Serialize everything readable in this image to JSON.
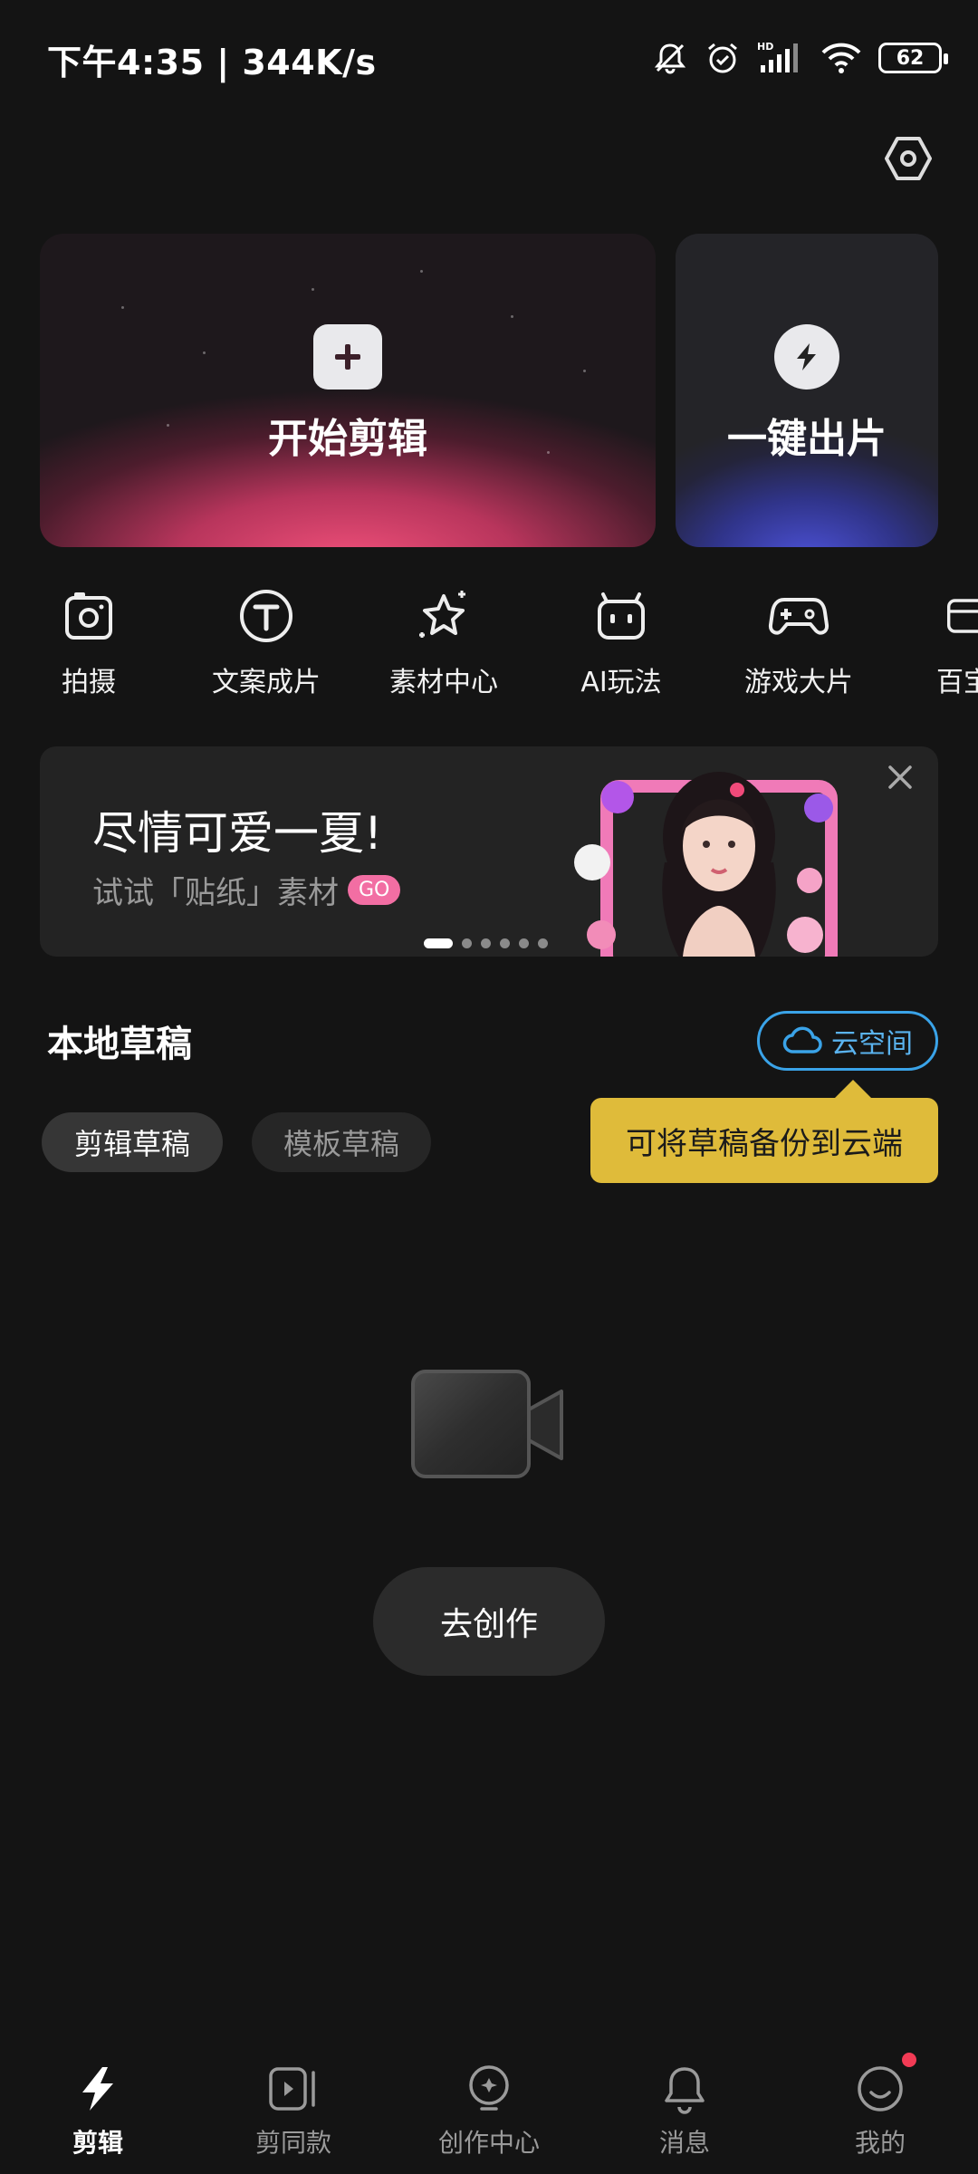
{
  "status_bar": {
    "time": "下午4:35 | 344K/s",
    "battery": "62",
    "icons": [
      "mute-icon",
      "alarm-icon",
      "hd-signal-icon",
      "wifi-icon",
      "battery-icon"
    ]
  },
  "header": {
    "settings_icon": "settings-hexagon-icon"
  },
  "hero": {
    "edit": {
      "label": "开始剪辑",
      "icon": "plus-icon"
    },
    "quick": {
      "label": "一键出片",
      "icon": "lightning-icon"
    }
  },
  "tools": [
    {
      "label": "拍摄",
      "icon": "camera-icon"
    },
    {
      "label": "文案成片",
      "icon": "text-t-icon"
    },
    {
      "label": "素材中心",
      "icon": "star-sparkle-icon"
    },
    {
      "label": "AI玩法",
      "icon": "robot-icon"
    },
    {
      "label": "游戏大片",
      "icon": "gamepad-icon"
    },
    {
      "label": "百宝",
      "icon": "toolbox-icon"
    }
  ],
  "banner": {
    "title": "尽情可爱一夏!",
    "subtitle": "试试「贴纸」素材",
    "badge": "GO",
    "active_slide": 1,
    "slides": 6
  },
  "drafts": {
    "title": "本地草稿",
    "cloud_label": "云空间",
    "tooltip": "可将草稿备份到云端",
    "tabs": [
      "剪辑草稿",
      "模板草稿"
    ],
    "active_tab": "剪辑草稿",
    "empty_action": "去创作"
  },
  "bottom_nav": [
    {
      "label": "剪辑",
      "icon": "lightning-icon",
      "active": true
    },
    {
      "label": "剪同款",
      "icon": "play-template-icon",
      "active": false
    },
    {
      "label": "创作中心",
      "icon": "bulb-icon",
      "active": false
    },
    {
      "label": "消息",
      "icon": "bell-icon",
      "active": false
    },
    {
      "label": "我的",
      "icon": "smile-icon",
      "active": false,
      "badge": true
    }
  ],
  "colors": {
    "background": "#141414",
    "accent_blue": "#3aa3e8",
    "tooltip_yellow": "#dfbb3a",
    "badge_pink": "#f26ea3",
    "notification_red": "#f23b55"
  }
}
